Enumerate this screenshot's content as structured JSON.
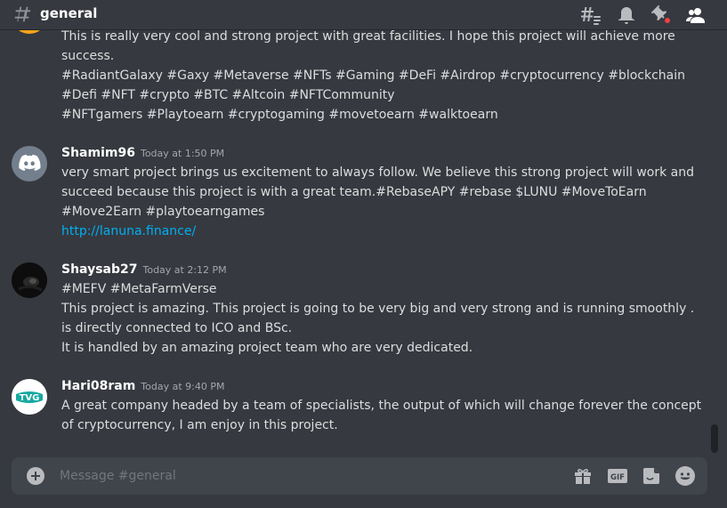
{
  "channel": {
    "name": "general"
  },
  "composer": {
    "placeholder": "Message #general"
  },
  "messages": [
    {
      "lines": [
        "This is really very cool and strong project with great facilities. I hope this project will achieve more",
        "success.",
        "#RadiantGalaxy #Gaxy #Metaverse #NFTs #Gaming #DeFi #Airdrop  #cryptocurrency #blockchain",
        "#Defi #NFT #crypto #BTC #Altcoin #NFTCommunity",
        "#NFTgamers #Playtoearn #cryptogaming #movetoearn #walktoearn"
      ]
    },
    {
      "author": "Shamim96",
      "timestamp": "Today at 1:50 PM",
      "lines": [
        "very smart project brings us excitement to always follow. We believe this strong project will work and",
        "succeed because this project is with a great team.#RebaseAPY #rebase $LUNU #MoveToEarn",
        "#Move2Earn #playtoearngames"
      ],
      "link": "http://lanuna.finance/"
    },
    {
      "author": "Shaysab27",
      "timestamp": "Today at 2:12 PM",
      "lines": [
        "#MEFV #MetaFarmVerse",
        "This project is amazing. This project is going to be very big and very strong and is running smoothly .",
        "is directly connected to ICO and BSc.",
        "It is handled by an amazing project team who are very dedicated."
      ]
    },
    {
      "author": "Hari08ram",
      "timestamp": "Today at 9:40 PM",
      "avatar_text": "TVG",
      "lines": [
        "A great company headed by a team of specialists, the output of which will change forever the concept",
        "of cryptocurrency, I am enjoy in this project."
      ]
    }
  ],
  "colors": {
    "background": "#36393f",
    "composer": "#40444b",
    "link": "#00aff4",
    "discord_blurple": "#5865f2",
    "notification_dot": "#ed4245",
    "partial_avatar": "#faa61a"
  },
  "icons": [
    "hash-icon",
    "threads-icon",
    "bell-icon",
    "pin-icon",
    "members-icon",
    "add-circle-icon",
    "gift-icon",
    "gif-icon",
    "sticker-icon",
    "emoji-icon"
  ]
}
